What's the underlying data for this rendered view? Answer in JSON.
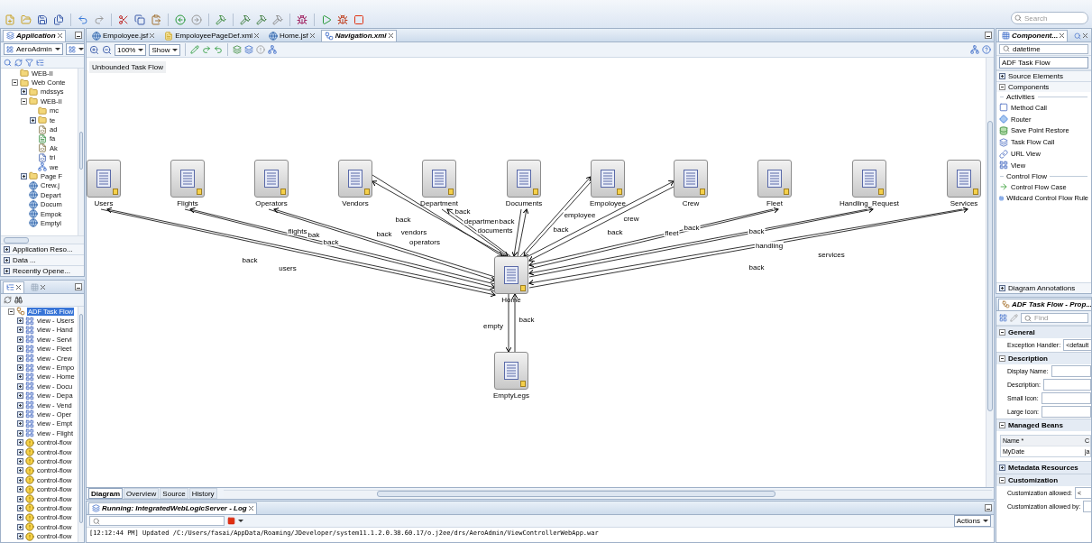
{
  "search": {
    "placeholder": "Search"
  },
  "application_panel": {
    "tab": "Application",
    "project": "AeroAdmin",
    "tree": [
      {
        "label": "WEB-II",
        "kind": "folder"
      },
      {
        "label": "Web Conte",
        "kind": "folder",
        "expanded": true,
        "children": [
          {
            "label": "mdssys",
            "kind": "folder",
            "expanded": false
          },
          {
            "label": "WEB-II",
            "kind": "folder",
            "expanded": true,
            "children": [
              {
                "label": "mc",
                "kind": "folder"
              },
              {
                "label": "te",
                "kind": "folder",
                "expanded": false
              },
              {
                "label": "ad",
                "kind": "config"
              },
              {
                "label": "fa",
                "kind": "faces"
              },
              {
                "label": "Ak",
                "kind": "config"
              },
              {
                "label": "tri",
                "kind": "xml"
              },
              {
                "label": "we",
                "kind": "web"
              }
            ]
          },
          {
            "label": "Page F",
            "kind": "folder",
            "expanded": false
          },
          {
            "label": "Crew.j",
            "kind": "page"
          },
          {
            "label": "Depart",
            "kind": "page"
          },
          {
            "label": "Docum",
            "kind": "page"
          },
          {
            "label": "Empok",
            "kind": "page"
          },
          {
            "label": "Emptyl",
            "kind": "page"
          }
        ]
      }
    ],
    "sections": [
      {
        "label": "Application Reso...",
        "expanded": false
      },
      {
        "label": "Data ...",
        "expanded": false
      },
      {
        "label": "Recently Opene...",
        "expanded": false
      }
    ]
  },
  "structure_panel": {
    "tree": [
      {
        "label": "ADF Task Flow",
        "kind": "flow",
        "expanded": true,
        "selected": true,
        "children": [
          {
            "label": "view - Users",
            "kind": "view",
            "expanded": false,
            "selected": false
          },
          {
            "label": "view - Hand",
            "kind": "view",
            "expanded": false,
            "selected": false
          },
          {
            "label": "view - Servi",
            "kind": "view",
            "expanded": false,
            "selected": false
          },
          {
            "label": "view - Fleet",
            "kind": "view",
            "expanded": false,
            "selected": false
          },
          {
            "label": "view - Crew",
            "kind": "view",
            "expanded": false,
            "selected": false
          },
          {
            "label": "view - Empo",
            "kind": "view",
            "expanded": false,
            "selected": false
          },
          {
            "label": "view - Home",
            "kind": "view",
            "expanded": false,
            "selected": false
          },
          {
            "label": "view - Docu",
            "kind": "view",
            "expanded": false,
            "selected": false
          },
          {
            "label": "view - Depa",
            "kind": "view",
            "expanded": false,
            "selected": false
          },
          {
            "label": "view - Vend",
            "kind": "view",
            "expanded": false,
            "selected": false
          },
          {
            "label": "view - Oper",
            "kind": "view",
            "expanded": false,
            "selected": false
          },
          {
            "label": "view - Empt",
            "kind": "view",
            "expanded": false,
            "selected": false
          },
          {
            "label": "view - Flight",
            "kind": "view",
            "expanded": false,
            "selected": false
          },
          {
            "label": "control-flow",
            "kind": "control",
            "expanded": false,
            "selected": false
          },
          {
            "label": "control-flow",
            "kind": "control",
            "expanded": false,
            "selected": false
          },
          {
            "label": "control-flow",
            "kind": "control",
            "expanded": false,
            "selected": false
          },
          {
            "label": "control-flow",
            "kind": "control",
            "expanded": false,
            "selected": false
          },
          {
            "label": "control-flow",
            "kind": "control",
            "expanded": false,
            "selected": false
          },
          {
            "label": "control-flow",
            "kind": "control",
            "expanded": false,
            "selected": false
          },
          {
            "label": "control-flow",
            "kind": "control",
            "expanded": false,
            "selected": false
          },
          {
            "label": "control-flow",
            "kind": "control",
            "expanded": false,
            "selected": false
          },
          {
            "label": "control-flow",
            "kind": "control",
            "expanded": false,
            "selected": false
          },
          {
            "label": "control-flow",
            "kind": "control",
            "expanded": false,
            "selected": false
          },
          {
            "label": "control-flow",
            "kind": "control",
            "expanded": false,
            "selected": false
          }
        ]
      }
    ]
  },
  "editor": {
    "tabs": [
      {
        "label": "Empoloyee.jsf",
        "kind": "page",
        "selected": false
      },
      {
        "label": "EmpoloyeePageDef.xml",
        "kind": "pagedef",
        "selected": false
      },
      {
        "label": "Home.jsf",
        "kind": "page",
        "selected": false
      },
      {
        "label": "Navigation.xml",
        "kind": "diagram",
        "selected": true
      }
    ],
    "zoom": "100%",
    "show": "Show",
    "flow_label": "Unbounded Task Flow",
    "nodes": [
      {
        "label": "Users"
      },
      {
        "label": "Flights"
      },
      {
        "label": "Operators"
      },
      {
        "label": "Vendors"
      },
      {
        "label": "Department"
      },
      {
        "label": "Documents"
      },
      {
        "label": "Empoloyee"
      },
      {
        "label": "Crew"
      },
      {
        "label": "Fleet"
      },
      {
        "label": "Handling_Request"
      },
      {
        "label": "Services"
      },
      {
        "label": "Home"
      },
      {
        "label": "EmptyLegs"
      }
    ],
    "edge_labels": [
      "back",
      "users",
      "flights",
      "bak",
      "back",
      "back",
      "back",
      "vendors",
      "operators",
      "back",
      "department",
      "back",
      "documents",
      "employee",
      "crew",
      "back",
      "back",
      "fleet",
      "back",
      "back",
      "handling",
      "services",
      "back",
      "empty",
      "back"
    ],
    "view_tabs": [
      {
        "label": "Diagram",
        "selected": true
      },
      {
        "label": "Overview",
        "selected": false
      },
      {
        "label": "Source",
        "selected": false
      },
      {
        "label": "History",
        "selected": false
      }
    ]
  },
  "log": {
    "tab": "Running: IntegratedWebLogicServer - Log",
    "actions": "Actions",
    "lines": [
      "[12:12:44 PM] Updated /C:/Users/fasai/AppData/Roaming/JDeveloper/system11.1.2.0.38.60.17/o.j2ee/drs/AeroAdmin/ViewControllerWebApp.war"
    ]
  },
  "components_panel": {
    "tab": "Component...",
    "search": "datetime",
    "palette": "ADF Task Flow",
    "sections": [
      {
        "label": "Source Elements",
        "expanded": false
      },
      {
        "label": "Components",
        "expanded": true,
        "groups": [
          {
            "label": "Activities",
            "items": [
              {
                "label": "Method Call",
                "kind": "method"
              },
              {
                "label": "Router",
                "kind": "router"
              },
              {
                "label": "Save Point Restore",
                "kind": "restore"
              },
              {
                "label": "Task Flow Call",
                "kind": "call"
              },
              {
                "label": "URL View",
                "kind": "url"
              },
              {
                "label": "View",
                "kind": "view"
              }
            ]
          },
          {
            "label": "Control Flow",
            "items": [
              {
                "label": "Control Flow Case",
                "kind": "case"
              },
              {
                "label": "Wildcard Control Flow Rule",
                "kind": "wildcard"
              }
            ]
          }
        ]
      },
      {
        "label": "Diagram Annotations",
        "expanded": false
      }
    ]
  },
  "properties_panel": {
    "tab": "ADF Task Flow - Prop...",
    "find_placeholder": "Find",
    "sections": [
      {
        "label": "General",
        "expanded": true,
        "kind": "fields",
        "fields": [
          {
            "label": "Exception Handler:",
            "value": "<default",
            "kind": "select"
          }
        ]
      },
      {
        "label": "Description",
        "expanded": true,
        "kind": "fields",
        "fields": [
          {
            "label": "Display Name:",
            "kind": "text"
          },
          {
            "label": "Description:",
            "kind": "text"
          },
          {
            "label": "Small Icon:",
            "kind": "text"
          },
          {
            "label": "Large Icon:",
            "kind": "text"
          }
        ]
      },
      {
        "label": "Managed Beans",
        "expanded": true,
        "kind": "table",
        "columns": [
          "Name *",
          "C"
        ],
        "rows": [
          [
            "MyDate",
            "ja"
          ]
        ]
      },
      {
        "label": "Metadata Resources",
        "expanded": false
      },
      {
        "label": "Customization",
        "expanded": true,
        "kind": "fields",
        "fields": [
          {
            "label": "Customization allowed:",
            "value": "<",
            "kind": "select"
          },
          {
            "label": "Customization allowed by:",
            "kind": "text"
          }
        ]
      }
    ]
  }
}
